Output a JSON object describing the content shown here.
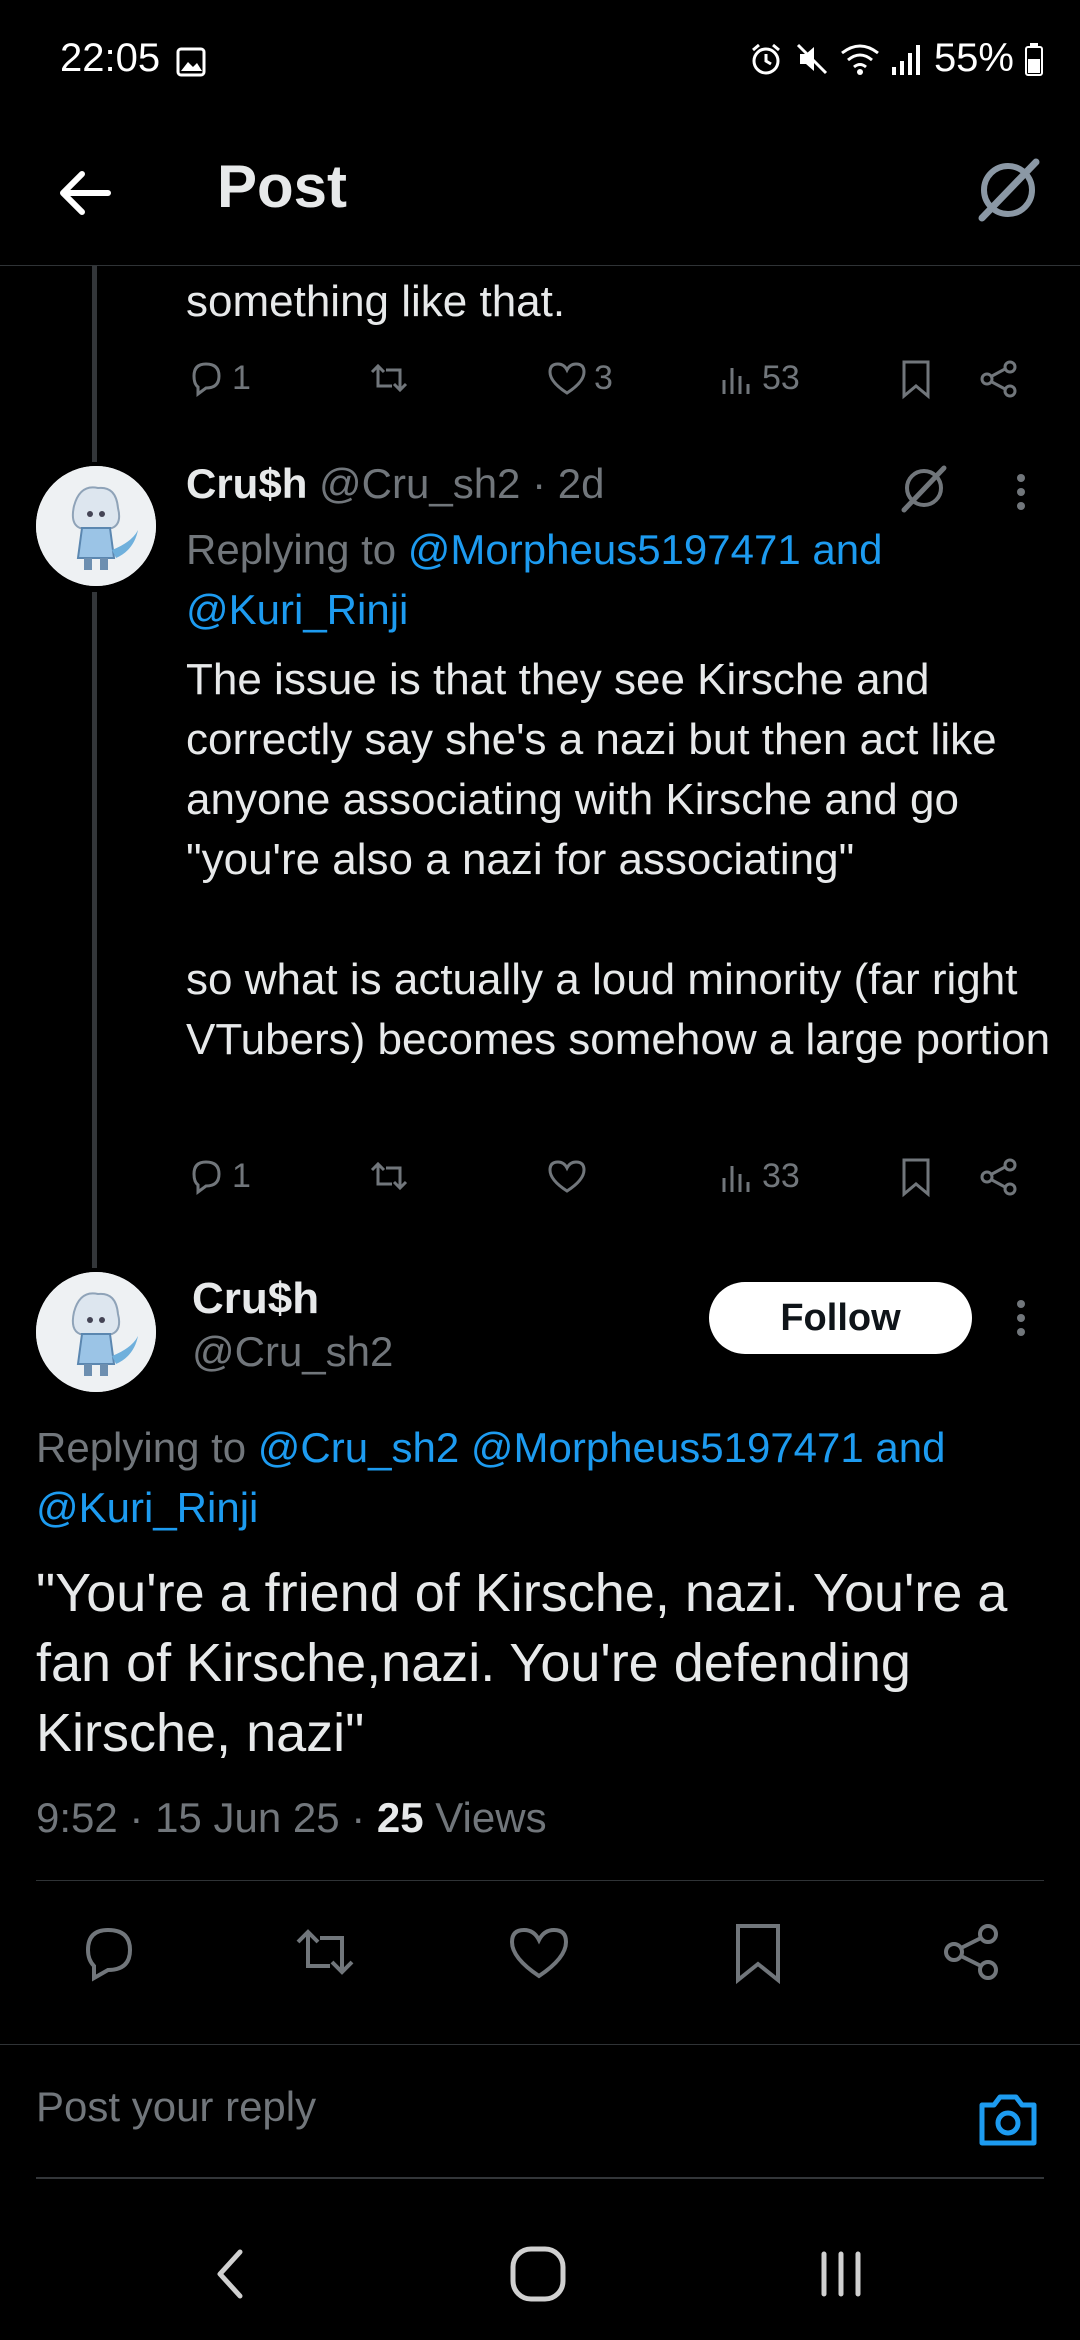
{
  "status_bar": {
    "time": "22:05",
    "battery": "55%"
  },
  "header": {
    "title": "Post"
  },
  "prev_tweet": {
    "text_tail": "something like that.",
    "replies": "1",
    "reposts": "",
    "likes": "3",
    "views": "53"
  },
  "reply_tweet": {
    "author": "Cru$h",
    "handle": "@Cru_sh2",
    "time": "· 2d",
    "replying_prefix": "Replying to",
    "replying_to": "@Morpheus5197471 and",
    "replying_to_2": "@Kuri_Rinji",
    "text_1": "The issue is that they see Kirsche and correctly say she's a nazi but then act like anyone associating with Kirsche and go \"you're also a nazi for associating\"",
    "text_2": "so what is actually a loud minority (far right VTubers) becomes somehow a large portion",
    "replies": "1",
    "reposts": "",
    "likes": "",
    "views": "33"
  },
  "main_tweet": {
    "author": "Cru$h",
    "handle": "@Cru_sh2",
    "follow_label": "Follow",
    "replying_prefix": "Replying to",
    "replying_to": "@Cru_sh2 @Morpheus5197471 and",
    "replying_to_2": "@Kuri_Rinji",
    "text": "\"You're a friend of Kirsche, nazi. You're a fan of Kirsche,nazi. You're defending Kirsche, nazi\"",
    "time": "9:52",
    "date": "15 Jun 25",
    "views_count": "25",
    "views_label": "Views"
  },
  "reply_box": {
    "placeholder": "Post your reply"
  },
  "colors": {
    "accent": "#1d9bf0",
    "dim": "#71767b",
    "background": "#000000"
  }
}
